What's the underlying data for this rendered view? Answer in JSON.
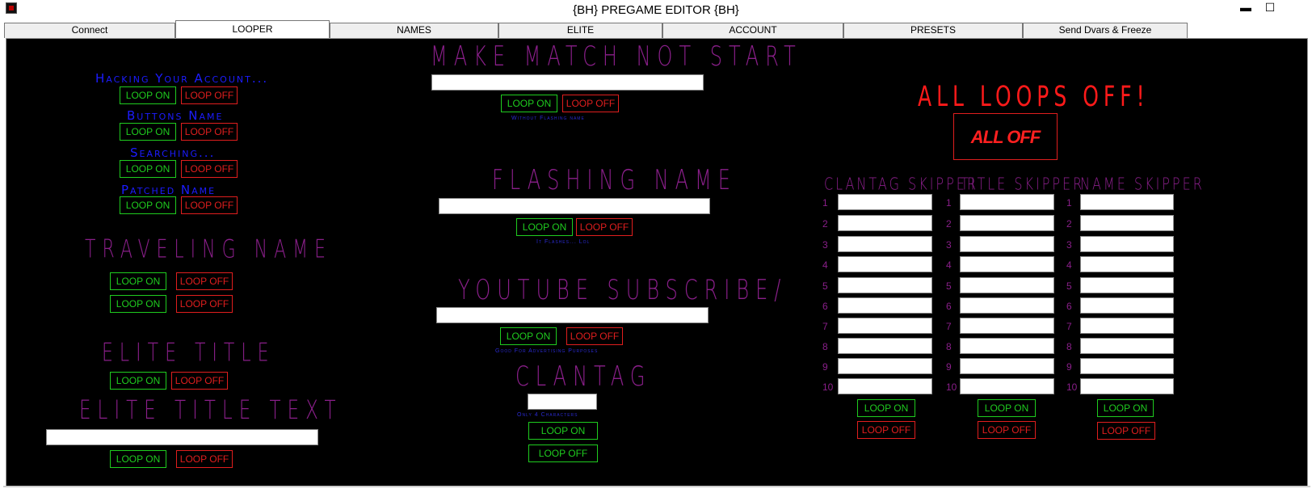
{
  "window": {
    "title": "{BH} PREGAME EDITOR {BH}",
    "minimize": "▬",
    "maximize": "☐"
  },
  "tabs": [
    "Connect",
    "LOOPER",
    "NAMES",
    "ELITE",
    "ACCOUNT",
    "PRESETS",
    "Send Dvars & Freeze"
  ],
  "active_tab": "LOOPER",
  "left": {
    "hacking_label": "Hacking Your Account...",
    "buttons_label": "Buttons Name",
    "searching_label": "Searching...",
    "patched_label": "Patched Name",
    "traveling_heading": "TRAVELING NAME",
    "elite_title_heading": "ELITE TITLE",
    "elite_title_text_heading": "ELITE TITLE TEXT",
    "elite_title_text_value": ""
  },
  "middle": {
    "make_match_heading": "MAKE MATCH NOT START",
    "make_match_value": "",
    "make_match_note": "Without Flashing name",
    "flashing_heading": "FLASHING NAME",
    "flashing_value": "",
    "flashing_note": "It Flashes... Lol",
    "youtube_heading": "YOUTUBE SUBSCRIBE/",
    "youtube_value": "",
    "youtube_note": "Good For Advertising Purposes",
    "clantag_heading": "CLANTAG",
    "clantag_value": "",
    "clantag_note": "Only 4 Characters"
  },
  "right": {
    "all_loops_heading": "ALL LOOPS OFF!",
    "all_off_button": "ALL OFF",
    "clantag_skipper": "CLANTAG SKIPPER",
    "title_skipper": "TITLE SKIPPER",
    "name_skipper": "NAME SKIPPER",
    "row_numbers": [
      "1",
      "2",
      "3",
      "4",
      "5",
      "6",
      "7",
      "8",
      "9",
      "10"
    ]
  },
  "labels": {
    "loop_on": "LOOP ON",
    "loop_off": "LOOP OFF"
  },
  "colors": {
    "panel_bg": "#000000",
    "on_green": "#1fcc1f",
    "off_red": "#e01e1e",
    "heading_purple": "#8a1f8a",
    "label_blue": "#1c1cff"
  }
}
